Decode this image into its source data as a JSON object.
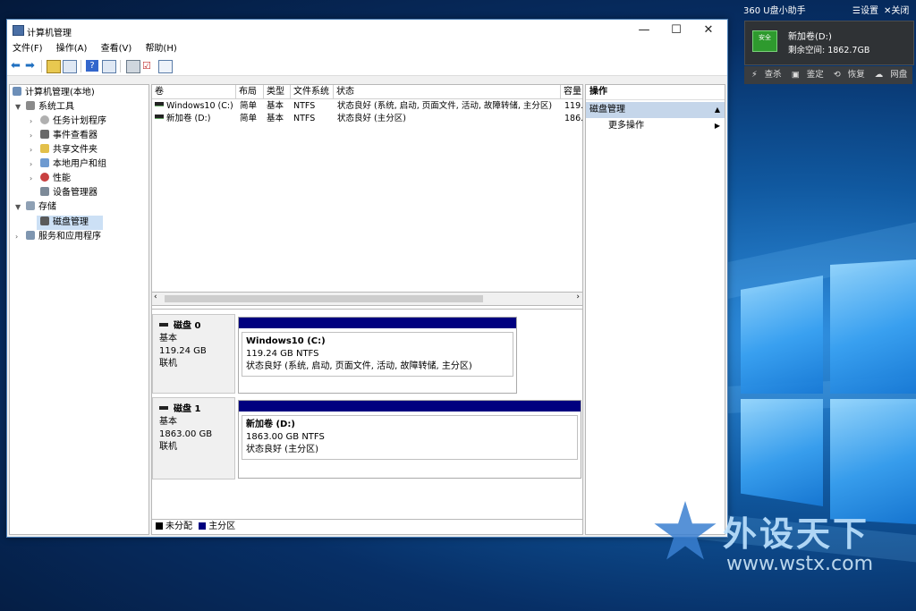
{
  "window": {
    "title": "计算机管理",
    "controls": {
      "minimize": "—",
      "maximize": "☐",
      "close": "✕"
    }
  },
  "menu": [
    "文件(F)",
    "操作(A)",
    "查看(V)",
    "帮助(H)"
  ],
  "tree": {
    "root": "计算机管理(本地)",
    "system_tools": "系统工具",
    "task_scheduler": "任务计划程序",
    "event_viewer": "事件查看器",
    "shared_folders": "共享文件夹",
    "local_users": "本地用户和组",
    "performance": "性能",
    "device_manager": "设备管理器",
    "storage": "存储",
    "disk_management": "磁盘管理",
    "services": "服务和应用程序"
  },
  "volume_list": {
    "headers": [
      "卷",
      "布局",
      "类型",
      "文件系统",
      "状态",
      "容量"
    ],
    "rows": [
      [
        "Windows10 (C:)",
        "简单",
        "基本",
        "NTFS",
        "状态良好 (系统, 启动, 页面文件, 活动, 故障转储, 主分区)",
        "119."
      ],
      [
        "新加卷 (D:)",
        "简单",
        "基本",
        "NTFS",
        "状态良好 (主分区)",
        "186."
      ]
    ]
  },
  "disks": [
    {
      "name": "磁盘 0",
      "type": "基本",
      "size": "119.24 GB",
      "state": "联机",
      "partition": {
        "label": "Windows10  (C:)",
        "size": "119.24 GB NTFS",
        "status": "状态良好 (系统, 启动, 页面文件, 活动, 故障转储, 主分区)"
      }
    },
    {
      "name": "磁盘 1",
      "type": "基本",
      "size": "1863.00 GB",
      "state": "联机",
      "partition": {
        "label": "新加卷  (D:)",
        "size": "1863.00 GB NTFS",
        "status": "状态良好 (主分区)"
      }
    }
  ],
  "legend": {
    "unallocated": "未分配",
    "primary": "主分区",
    "colors": {
      "unallocated": "#000000",
      "primary": "#00007f"
    }
  },
  "actions": {
    "header": "操作",
    "selected": "磁盘管理",
    "more": "更多操作"
  },
  "usb_widget": {
    "title": "360 U盘小助手",
    "settings": "设置",
    "close": "关闭",
    "badge": "安全",
    "drive": "新加卷(D:)",
    "free_space": "剩余空间: 1862.7GB",
    "buttons": [
      "查杀",
      "鉴定",
      "恢复",
      "网盘"
    ]
  },
  "watermark": {
    "title": "外设天下",
    "url": "www.wstx.com"
  }
}
